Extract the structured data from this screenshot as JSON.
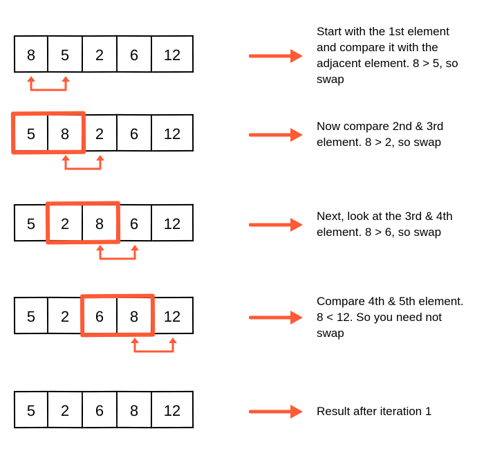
{
  "accent": "#ff5a36",
  "steps": [
    {
      "values": [
        "8",
        "5",
        "2",
        "6",
        "12"
      ],
      "highlight_span": null,
      "swap_under": [
        0,
        1
      ],
      "description": "Start with the 1st element and compare it with the adjacent element. 8 > 5, so swap"
    },
    {
      "values": [
        "5",
        "8",
        "2",
        "6",
        "12"
      ],
      "highlight_span": [
        0,
        1
      ],
      "swap_under": [
        1,
        2
      ],
      "description": "Now compare 2nd & 3rd element. 8 > 2, so swap"
    },
    {
      "values": [
        "5",
        "2",
        "8",
        "6",
        "12"
      ],
      "highlight_span": [
        1,
        2
      ],
      "swap_under": [
        2,
        3
      ],
      "description": "Next, look at the 3rd & 4th element. 8 > 6, so swap"
    },
    {
      "values": [
        "5",
        "2",
        "6",
        "8",
        "12"
      ],
      "highlight_span": [
        2,
        3
      ],
      "swap_under": [
        3,
        4
      ],
      "description": "Compare 4th & 5th element. 8 < 12. So you need not swap"
    },
    {
      "values": [
        "5",
        "2",
        "6",
        "8",
        "12"
      ],
      "highlight_span": null,
      "swap_under": null,
      "description": "Result after iteration 1"
    }
  ]
}
